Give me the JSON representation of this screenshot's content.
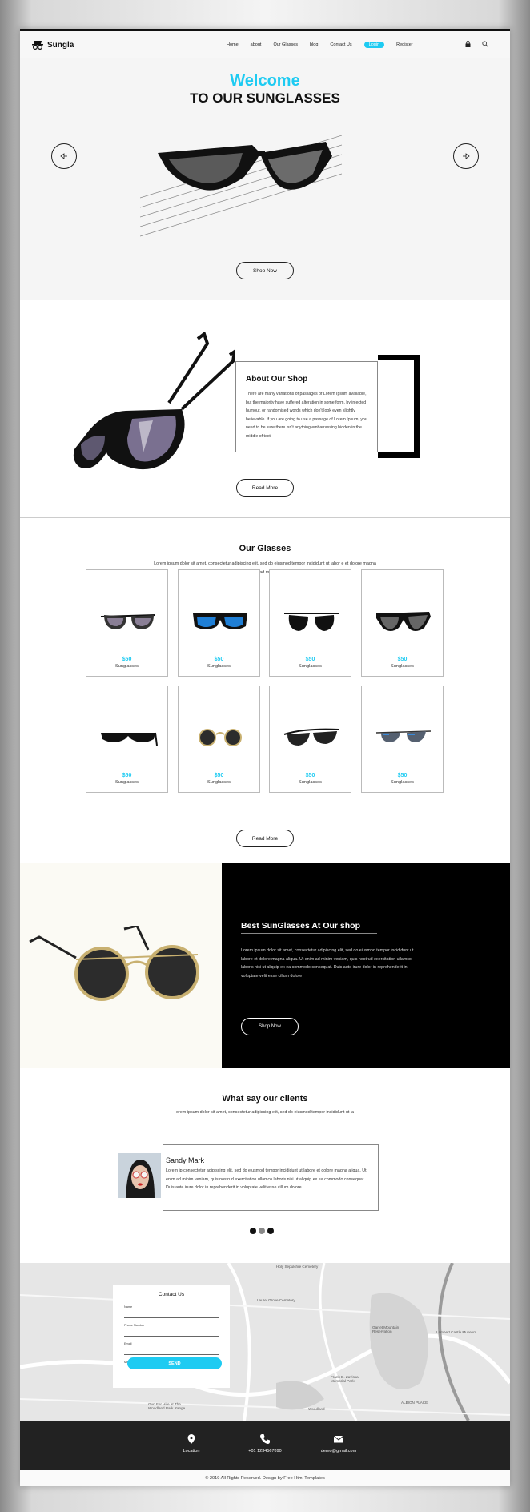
{
  "brand": {
    "name": "Sungla",
    "accent": "#1ecbf2"
  },
  "nav": {
    "items": [
      "Home",
      "about",
      "Our Glasses",
      "blog",
      "Contact Us"
    ],
    "login": "Login",
    "register": "Register"
  },
  "header_icons": [
    "lock-icon",
    "search-icon"
  ],
  "hero": {
    "welcome": "Welcome",
    "title": "TO OUR SUNGLASSES",
    "button": "Shop Now"
  },
  "about": {
    "title": "About Our Shop",
    "text": "There are many variations of passages of Lorem Ipsum available, but the majority have suffered alteration in some form, by injected humour, or randomised words which don't look even slightly believable. If you are going to use a passage of Lorem Ipsum, you need to be sure there isn't anything embarrassing hidden in the middle of text.",
    "button": "Read More"
  },
  "glasses": {
    "title": "Our  Glasses",
    "subtitle": "Lorem ipsum dolor sit amet, consectetur adipiscing elit, sed do eiusmod tempor incididunt ut labor e et dolore magna aliqua. Ut enim ad minim veniam, qui",
    "products": [
      {
        "price": "$50",
        "name": "Sunglasses"
      },
      {
        "price": "$50",
        "name": "Sunglasses"
      },
      {
        "price": "$50",
        "name": "Sunglasses"
      },
      {
        "price": "$50",
        "name": "Sunglasses"
      },
      {
        "price": "$50",
        "name": "Sunglasses"
      },
      {
        "price": "$50",
        "name": "Sunglasses"
      },
      {
        "price": "$50",
        "name": "Sunglasses"
      },
      {
        "price": "$50",
        "name": "Sunglasses"
      }
    ],
    "button": "Read More"
  },
  "best": {
    "title": "Best SunGlasses  At Our shop",
    "text": "Lorem ipsum dolor sit amet, consectetur adipiscing elit, sed do eiusmod tempor incididunt ut labore et dolore magna aliqua. Ut enim ad minim veniam, quis nostrud exercitation ullamco laboris nisi ut aliquip ex ea commodo consequat. Duis aute irure dolor in reprehenderit in voluptate velit esse cillum dolore",
    "button": "Shop Now"
  },
  "clients": {
    "title": "What say our clients",
    "subtitle": "orem ipsum dolor sit amet, consectetur adipiscing elit, sed do eiusmod tempor incididunt ut la",
    "testimonial": {
      "name": "Sandy Mark",
      "text": "Lorem ip consectetur adipiscing elit, sed do eiusmod tempor incididunt ut labore et dolore magna aliqua. Ut enim ad minim veniam, quis nostrud exercitation ullamco laboris nisi ut aliquip ex ea commodo consequat. Duis aute irure dolor in reprehenderit in voluptate velit esse cillum dolore"
    }
  },
  "contact": {
    "title": "Contact Us",
    "fields": [
      "Name",
      "Phone Number",
      "Email",
      "Message"
    ],
    "button": "SEND"
  },
  "map_labels": [
    "Holy Sepulchre Cemetery",
    "Laurel Grove Cemetery",
    "Lambert Castle Museum",
    "Garret Mountain Reservation",
    "Frank D. Zaviska Memorial Park",
    "Gun For Hire at The Woodland Park Range",
    "ALBION PLACE",
    "Woodland"
  ],
  "footer": {
    "location": "Location",
    "phone": "+01 1234567890",
    "email": "demo@gmail.com",
    "copyright": "© 2019 All Rights Reserved. Design by Free Html Templates"
  }
}
